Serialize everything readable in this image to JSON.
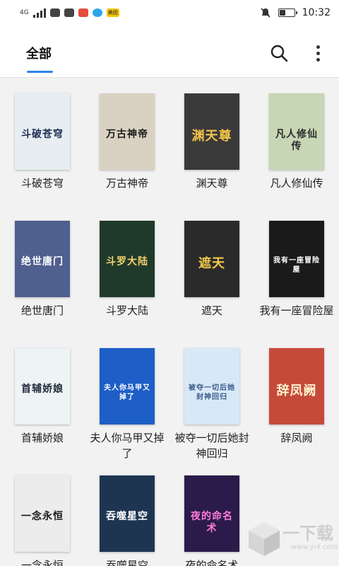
{
  "statusbar": {
    "network": "4G",
    "time": "10:32",
    "battery_level": 0.4,
    "app_badge": "美团",
    "icons": [
      "signal-icon",
      "mail-icon",
      "message-icon",
      "photo-app-icon",
      "browser-icon",
      "meituan-icon",
      "mute-icon",
      "battery-icon"
    ]
  },
  "header": {
    "tab": "全部",
    "search_icon": "search-icon",
    "more_icon": "more-vertical-icon"
  },
  "books": [
    {
      "title": "斗破苍穹",
      "cover_text": "斗破苍穹",
      "cover_bg": "#e8edf2",
      "cover_fg": "#1d2f55"
    },
    {
      "title": "万古神帝",
      "cover_text": "万古神帝",
      "cover_bg": "#d9d2c2",
      "cover_fg": "#1a1a1a"
    },
    {
      "title": "渊天尊",
      "cover_text": "渊天尊",
      "cover_bg": "#3a3a3a",
      "cover_fg": "#f0c14b"
    },
    {
      "title": "凡人修仙传",
      "cover_text": "凡人修仙传",
      "cover_bg": "#c7d6b4",
      "cover_fg": "#2b2b2b"
    },
    {
      "title": "绝世唐门",
      "cover_text": "绝世唐门",
      "cover_bg": "#4f5f8f",
      "cover_fg": "#ffffff"
    },
    {
      "title": "斗罗大陆",
      "cover_text": "斗罗大陆",
      "cover_bg": "#1f3a2a",
      "cover_fg": "#f2d16b"
    },
    {
      "title": "遮天",
      "cover_text": "遮天",
      "cover_bg": "#2a2a2a",
      "cover_fg": "#f2c94c"
    },
    {
      "title": "我有一座冒险屋",
      "cover_text": "我有一座冒险屋",
      "cover_bg": "#1a1a1a",
      "cover_fg": "#ffffff"
    },
    {
      "title": "首辅娇娘",
      "cover_text": "首辅娇娘",
      "cover_bg": "#eef3f6",
      "cover_fg": "#1f2b3a"
    },
    {
      "title": "夫人你马甲又掉了",
      "cover_text": "夫人你马甲又掉了",
      "cover_bg": "#1d5ec7",
      "cover_fg": "#ffffff"
    },
    {
      "title": "被夺一切后她封神回归",
      "cover_text": "被夺一切后她封神回归",
      "cover_bg": "#d7e9f7",
      "cover_fg": "#3a5a8a"
    },
    {
      "title": "辞凤阙",
      "cover_text": "辞凤阙",
      "cover_bg": "#c64a3a",
      "cover_fg": "#fff3d0"
    },
    {
      "title": "一念永恒",
      "cover_text": "一念永恒",
      "cover_bg": "#ececec",
      "cover_fg": "#1a1a1a"
    },
    {
      "title": "吞噬星空",
      "cover_text": "吞噬星空",
      "cover_bg": "#1e3552",
      "cover_fg": "#ffffff"
    },
    {
      "title": "夜的命名术",
      "cover_text": "夜的命名术",
      "cover_bg": "#2b1b4a",
      "cover_fg": "#ff7ad9"
    }
  ],
  "watermark": {
    "text": "一下载",
    "url": "www.yi4.com"
  }
}
